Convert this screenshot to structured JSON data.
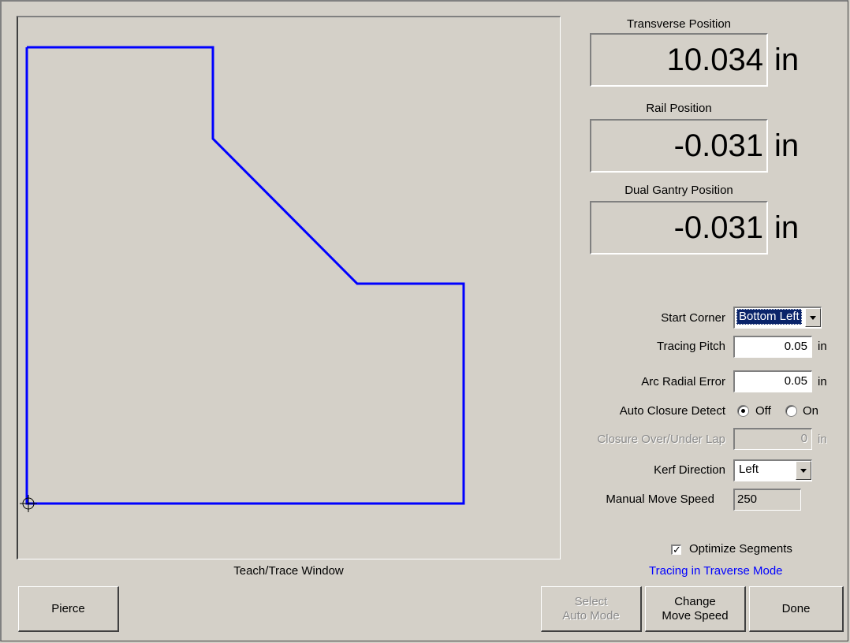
{
  "trace_window": {
    "caption": "Teach/Trace Window",
    "path_color": "#0000ff"
  },
  "positions": {
    "transverse": {
      "title": "Transverse Position",
      "value": "10.034",
      "unit": "in"
    },
    "rail": {
      "title": "Rail Position",
      "value": "-0.031",
      "unit": "in"
    },
    "dual_gantry": {
      "title": "Dual Gantry Position",
      "value": "-0.031",
      "unit": "in"
    }
  },
  "settings": {
    "start_corner": {
      "label": "Start Corner",
      "value": "Bottom Left"
    },
    "tracing_pitch": {
      "label": "Tracing Pitch",
      "value": "0.05",
      "unit": "in"
    },
    "arc_radial_error": {
      "label": "Arc Radial Error",
      "value": "0.05",
      "unit": "in"
    },
    "auto_closure_detect": {
      "label": "Auto Closure Detect",
      "off_label": "Off",
      "on_label": "On",
      "selected": "Off"
    },
    "closure_lap": {
      "label": "Closure Over/Under Lap",
      "value": "0",
      "unit": "in",
      "enabled": false
    },
    "kerf_direction": {
      "label": "Kerf Direction",
      "value": "Left"
    },
    "manual_move_speed": {
      "label": "Manual Move Speed",
      "value": "250"
    },
    "optimize_segments": {
      "label": "Optimize Segments",
      "checked": true
    }
  },
  "status_text": "Tracing in Traverse Mode",
  "buttons": {
    "pierce": "Pierce",
    "select_auto_mode": "Select\nAuto Mode",
    "change_move_speed": "Change\nMove Speed",
    "done": "Done"
  },
  "icons": {
    "crosshair": "crosshair-icon",
    "dropdown_arrow": "chevron-down-icon",
    "checkmark": "check-icon"
  }
}
